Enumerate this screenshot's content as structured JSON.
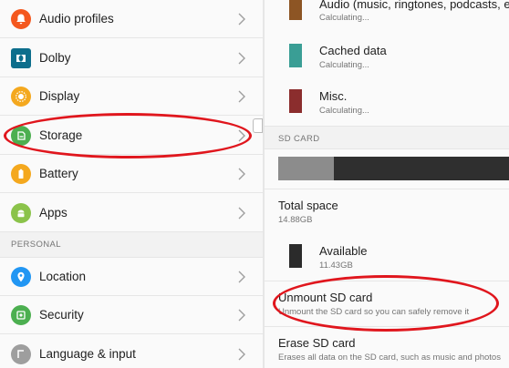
{
  "settings": {
    "items": [
      {
        "label": "Audio profiles",
        "icon": "bell-icon",
        "color": "#f4581e"
      },
      {
        "label": "Dolby",
        "icon": "dolby-icon",
        "color": "#0d6e8c"
      },
      {
        "label": "Display",
        "icon": "brightness-icon",
        "color": "#f4a81e"
      },
      {
        "label": "Storage",
        "icon": "sd-card-icon",
        "color": "#4caf50"
      },
      {
        "label": "Battery",
        "icon": "battery-icon",
        "color": "#f4a81e"
      },
      {
        "label": "Apps",
        "icon": "android-icon",
        "color": "#8bc34a"
      }
    ],
    "personal_header": "PERSONAL",
    "personal_items": [
      {
        "label": "Location",
        "icon": "location-icon",
        "color": "#2196f3"
      },
      {
        "label": "Security",
        "icon": "security-icon",
        "color": "#4caf50"
      },
      {
        "label": "Language & input",
        "icon": "language-icon",
        "color": "#9e9e9e"
      }
    ]
  },
  "storage": {
    "categories": [
      {
        "title": "Audio (music, ringtones, podcasts, etc.)",
        "sub": "Calculating...",
        "color": "#8d5524"
      },
      {
        "title": "Cached data",
        "sub": "Calculating...",
        "color": "#3a9e95"
      },
      {
        "title": "Misc.",
        "sub": "Calculating...",
        "color": "#8b2d2d"
      }
    ],
    "sd_header": "SD CARD",
    "usage_bar": {
      "used_fraction": 0.24,
      "used_color": "#8c8c8c",
      "free_color": "#2f2f2f"
    },
    "total_space": {
      "title": "Total space",
      "value": "14.88GB"
    },
    "available": {
      "title": "Available",
      "value": "11.43GB",
      "color": "#2b2b2b"
    },
    "unmount": {
      "title": "Unmount SD card",
      "sub": "Unmount the SD card so you can safely remove it"
    },
    "erase": {
      "title": "Erase SD card",
      "sub": "Erases all data on the SD card, such as music and photos"
    }
  },
  "highlight_color": "#e0161d"
}
